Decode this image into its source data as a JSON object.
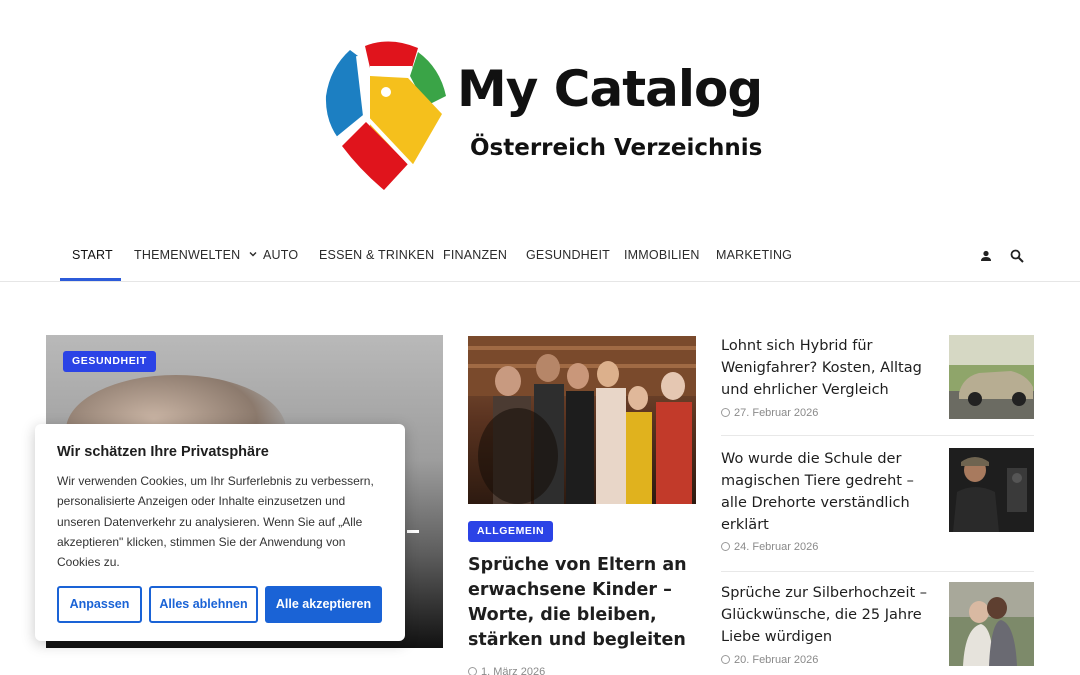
{
  "site": {
    "title": "My Catalog",
    "subtitle": "Österreich Verzeichnis"
  },
  "nav": {
    "items": [
      {
        "label": "START",
        "active": true
      },
      {
        "label": "THEMENWELTEN",
        "dropdown": true
      },
      {
        "label": "AUTO"
      },
      {
        "label": "ESSEN & TRINKEN"
      },
      {
        "label": "FINANZEN"
      },
      {
        "label": "GESUNDHEIT"
      },
      {
        "label": "IMMOBILIEN"
      },
      {
        "label": "MARKETING"
      }
    ],
    "icons": [
      "user-icon",
      "search-icon"
    ]
  },
  "hero": {
    "category": "GESUNDHEIT"
  },
  "featured": {
    "category": "ALLGEMEIN",
    "title": "Sprüche von Eltern an erwachsene Kinder – Worte, die bleiben, stärken und begleiten",
    "date": "1. März 2026"
  },
  "side_posts": [
    {
      "title": "Lohnt sich Hybrid für Wenigfahrer? Kosten, Alltag und ehrlicher Vergleich",
      "date": "27. Februar 2026"
    },
    {
      "title": "Wo wurde die Schule der magischen Tiere gedreht – alle Drehorte verständlich erklärt",
      "date": "24. Februar 2026"
    },
    {
      "title": "Sprüche zur Silberhochzeit – Glückwünsche, die 25 Jahre Liebe würdigen",
      "date": "20. Februar 2026"
    }
  ],
  "cookie": {
    "title": "Wir schätzen Ihre Privatsphäre",
    "text": "Wir verwenden Cookies, um Ihr Surferlebnis zu verbessern, personalisierte Anzeigen oder Inhalte einzusetzen und unseren Datenverkehr zu analysieren. Wenn Sie auf „Alle akzeptieren\" klicken, stimmen Sie der Anwendung von Cookies zu.",
    "btn_customize": "Anpassen",
    "btn_reject": "Alles ablehnen",
    "btn_accept": "Alle akzeptieren"
  },
  "colors": {
    "accent": "#2b43e6",
    "button": "#1a63d6",
    "logo_blue": "#1c7fc2",
    "logo_red": "#e0141c",
    "logo_yellow": "#f5c01c",
    "logo_green": "#3aa447"
  }
}
